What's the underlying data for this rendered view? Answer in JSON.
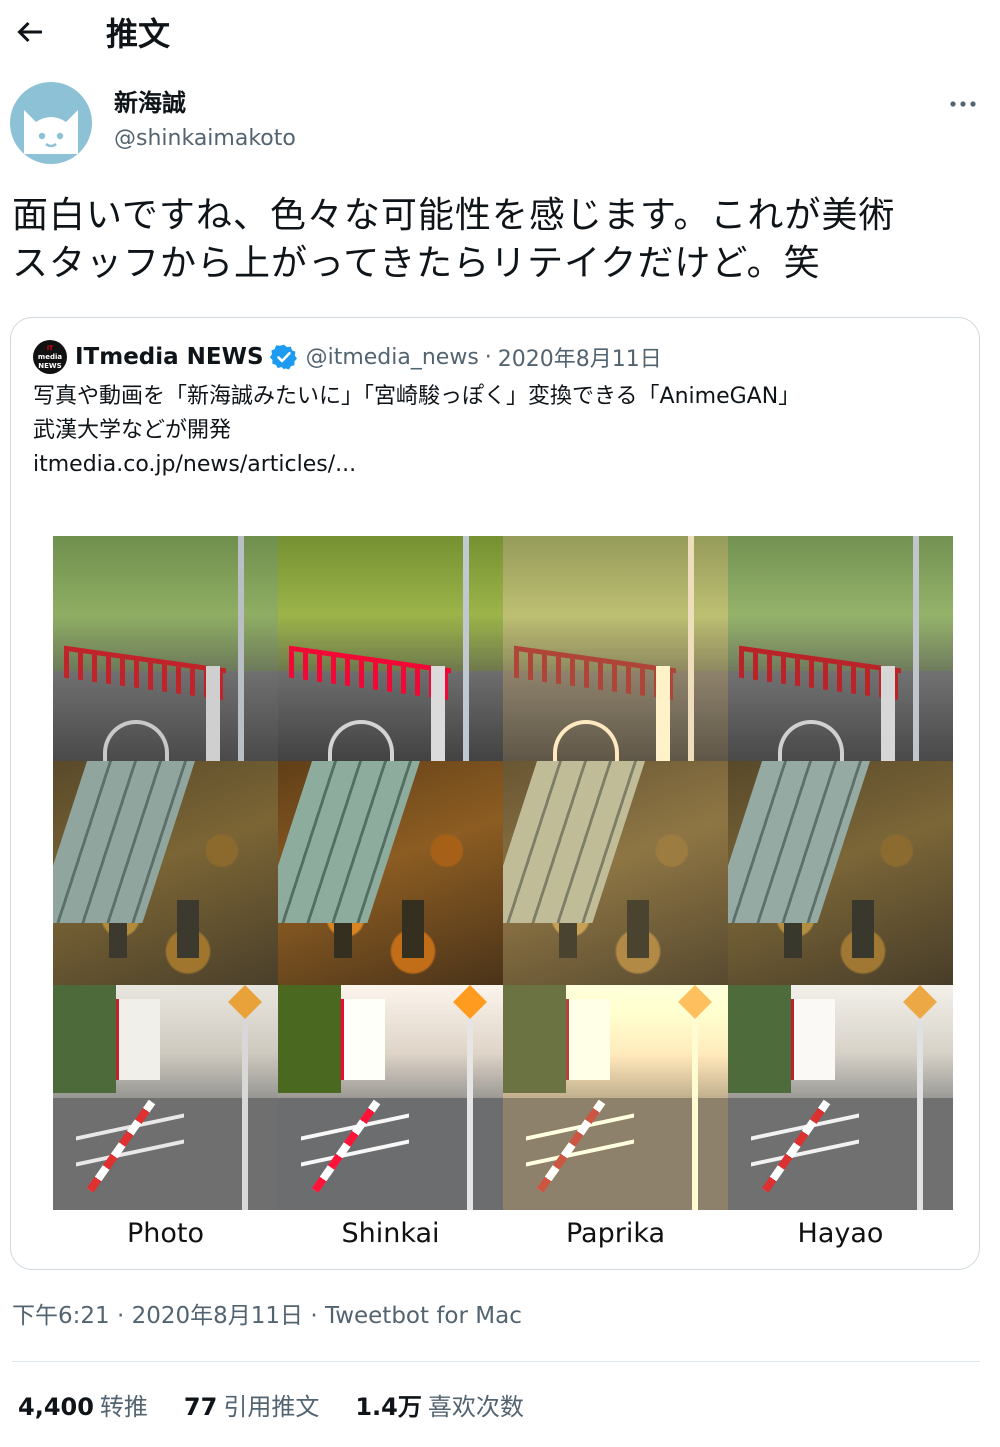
{
  "header": {
    "title": "推文",
    "back_icon": "arrow-left-icon"
  },
  "author": {
    "display_name": "新海誠",
    "handle": "@shinkaimakoto",
    "avatar_color": "#8dc1d6",
    "more_icon": "more-horizontal-icon"
  },
  "tweet": {
    "lines": [
      "面白いですね、色々な可能性を感じます。これが美術",
      "スタッフから上がってきたらリテイクだけど。笑"
    ]
  },
  "quote": {
    "avatar_text_top": "IT",
    "avatar_text_mid": "media",
    "avatar_text_bottom": "NEWS",
    "name": "ITmedia NEWS",
    "verified_icon": "verified-badge-icon",
    "verified_color": "#1d9bf0",
    "handle": "@itmedia_news",
    "separator": "·",
    "date": "2020年8月11日",
    "text_lines": [
      "写真や動画を「新海誠みたいに」「宮崎駿っぽく」変換できる「AnimeGAN」",
      "武漢大学などが開発",
      "itmedia.co.jp/news/articles/..."
    ],
    "captions": [
      "Photo",
      "Shinkai",
      "Paprika",
      "Hayao"
    ]
  },
  "meta": {
    "text": "下午6:21 · 2020年8月11日 · Tweetbot for Mac"
  },
  "stats": {
    "retweets_count": "4,400",
    "retweets_label": "转推",
    "quotes_count": "77",
    "quotes_label": "引用推文",
    "likes_count": "1.4万",
    "likes_label": "喜欢次数"
  }
}
